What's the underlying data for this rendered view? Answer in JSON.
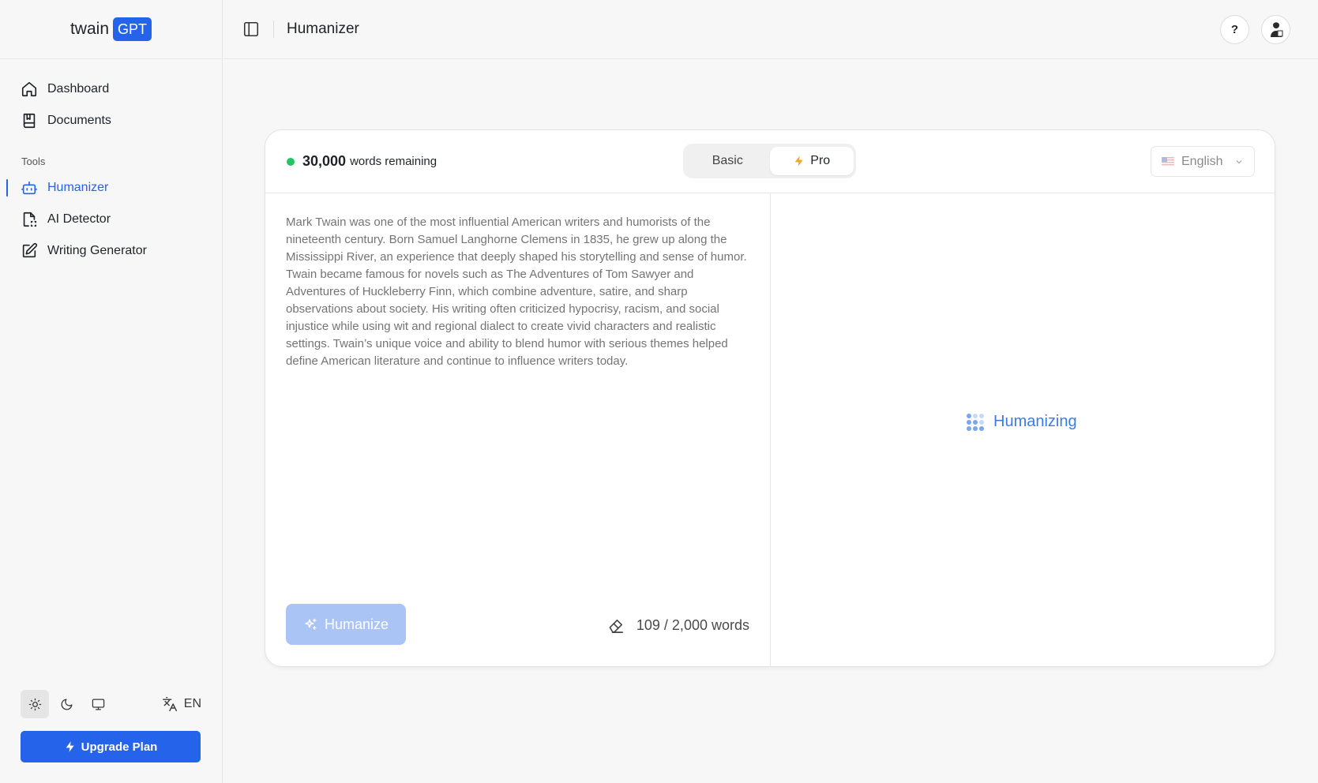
{
  "brand": {
    "name": "twain",
    "badge": "GPT"
  },
  "sidebar": {
    "items": [
      {
        "label": "Dashboard"
      },
      {
        "label": "Documents"
      }
    ],
    "tools_label": "Tools",
    "tools": [
      {
        "label": "Humanizer",
        "active": true
      },
      {
        "label": "AI Detector"
      },
      {
        "label": "Writing Generator"
      }
    ],
    "language": "EN",
    "upgrade_label": "Upgrade Plan"
  },
  "header": {
    "title": "Humanizer",
    "help": "?"
  },
  "card": {
    "credits_number": "30,000",
    "credits_text": "words remaining",
    "modes": [
      "Basic",
      "Pro"
    ],
    "active_mode": "Pro",
    "language": "English",
    "input_text": "Mark Twain was one of the most influential American writers and humorists of the nineteenth century. Born Samuel Langhorne Clemens in 1835, he grew up along the Mississippi River, an experience that deeply shaped his storytelling and sense of humor. Twain became famous for novels such as The Adventures of Tom Sawyer and Adventures of Huckleberry Finn, which combine adventure, satire, and sharp observations about society. His writing often criticized hypocrisy, racism, and social injustice while using wit and regional dialect to create vivid characters and realistic settings. Twain’s unique voice and ability to blend humor with serious themes helped define American literature and continue to influence writers today.",
    "humanize_label": "Humanize",
    "word_count": "109 / 2,000 words",
    "status": "Humanizing"
  },
  "colors": {
    "accent": "#2563eb",
    "status_dot": "#22c55e",
    "pro_bolt": "#f5a623"
  }
}
